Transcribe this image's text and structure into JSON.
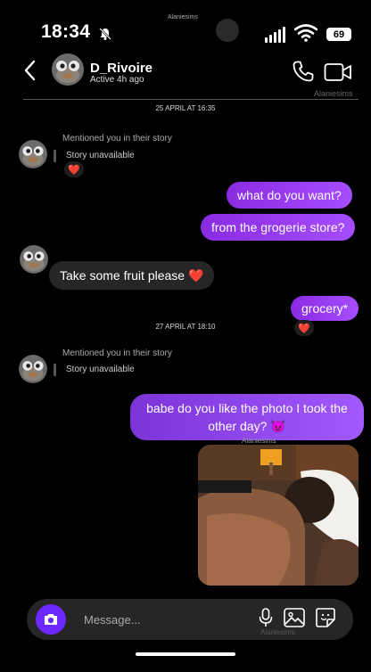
{
  "status_bar": {
    "time": "18:34",
    "battery": "69",
    "watermark": "Alaniesims"
  },
  "header": {
    "name": "D_Rivoire",
    "status": "Active 4h ago",
    "watermark": "Alaniesims"
  },
  "dates": {
    "first": "25 APRIL AT 16:35",
    "second": "27 APRIL AT 18:10"
  },
  "story": {
    "mention_label": "Mentioned you in their story",
    "unavailable": "Story unavailable"
  },
  "messages": {
    "out_1": "what do you want?",
    "out_2": "from the grogerie store?",
    "in_1": "Take some fruit please ❤️",
    "out_3": "grocery*",
    "out_4": "babe do you like the photo I took the other day? 😈"
  },
  "reactions": {
    "story_1": "❤️",
    "grocery": "❤️"
  },
  "photo_watermark": "Alaniesims",
  "composer": {
    "placeholder": "Message...",
    "watermark": "Alaniesims"
  },
  "colors": {
    "accent": "#8a2be2",
    "camera_button": "#6d28ff",
    "incoming_bubble": "#262626"
  }
}
